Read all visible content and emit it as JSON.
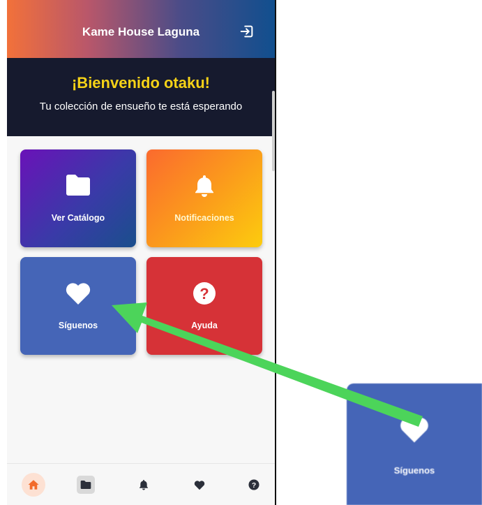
{
  "appbar": {
    "title": "Kame House Laguna",
    "logout_icon": "logout-icon"
  },
  "welcome": {
    "title": "¡Bienvenido otaku!",
    "subtitle": "Tu colección de ensueño te está esperando"
  },
  "cards": [
    {
      "label": "Ver Catálogo",
      "icon": "folder-icon"
    },
    {
      "label": "Notificaciones",
      "icon": "bell-icon"
    },
    {
      "label": "Síguenos",
      "icon": "heart-icon"
    },
    {
      "label": "Ayuda",
      "icon": "help-icon"
    }
  ],
  "bottom_nav": [
    "home-icon",
    "folder-icon",
    "bell-icon",
    "heart-icon",
    "help-icon"
  ],
  "zoom_inset": {
    "label": "Síguenos",
    "icon": "heart-icon"
  },
  "colors": {
    "accent_yellow": "#f5d217",
    "header_dark": "#161a2e",
    "card_blue": "#4565b7",
    "card_red": "#d63237",
    "arrow_green": "#4cd45a",
    "home_active": "#f26b2b"
  }
}
